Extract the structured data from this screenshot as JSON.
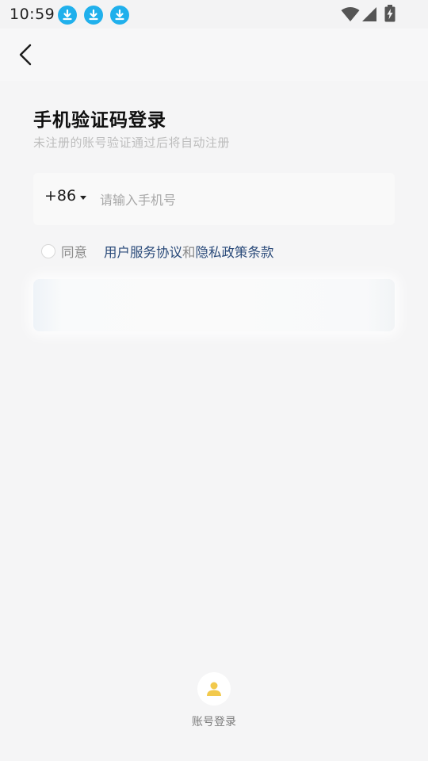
{
  "status_bar": {
    "time": "10:59",
    "notifications": [
      "download-icon",
      "download-icon",
      "download-icon"
    ],
    "icons": [
      "wifi-icon",
      "signal-icon",
      "battery-charging-icon"
    ],
    "download_color": "#20b0ec"
  },
  "header": {
    "back_icon": "chevron-left-icon"
  },
  "main": {
    "title": "手机验证码登录",
    "subtitle": "未注册的账号验证通过后将自动注册",
    "phone": {
      "country_code": "+86",
      "placeholder": "请输入手机号",
      "value": ""
    },
    "agreement": {
      "prefix": "同意",
      "terms_link": "用户服务协议",
      "conjunction": "和",
      "privacy_link": "隐私政策条款",
      "link_color": "#2b4b7a"
    }
  },
  "footer": {
    "account_login_label": "账号登录",
    "account_icon": "user-icon",
    "icon_color": "#f2c94c"
  }
}
